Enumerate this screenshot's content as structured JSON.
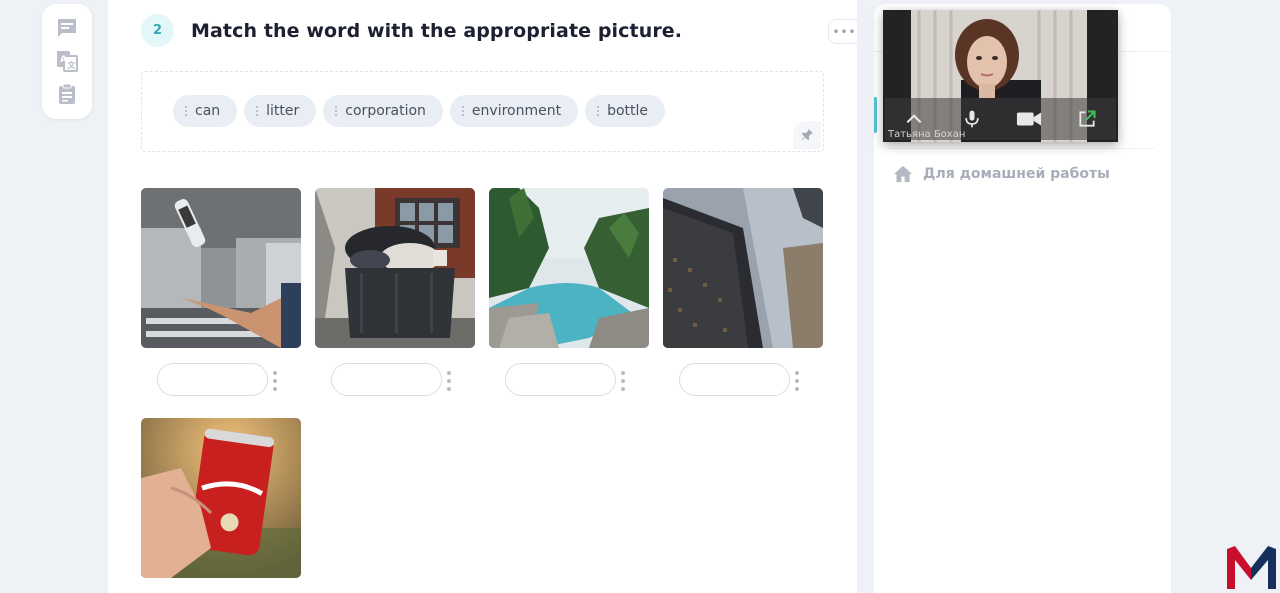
{
  "task": {
    "number": "2",
    "title": "Match the word with the appropriate picture.",
    "more_label": "•••"
  },
  "word_bank": [
    "can",
    "litter",
    "corporation",
    "environment",
    "bottle"
  ],
  "pictures": [
    {
      "subject": "tossed-can-factory",
      "answer": ""
    },
    {
      "subject": "overflowing-dumpster",
      "answer": ""
    },
    {
      "subject": "river-forest",
      "answer": ""
    },
    {
      "subject": "office-skyscraper",
      "answer": ""
    },
    {
      "subject": "hand-holding-red-can",
      "answer": ""
    }
  ],
  "side_panel": {
    "homework_label": "Для домашней работы"
  },
  "video": {
    "participant_name": "Татьяна Бохан"
  },
  "icons": {
    "toolbar": [
      "chat-icon",
      "translate-icon",
      "clipboard-icon"
    ],
    "video": [
      "chevron-up-icon",
      "microphone-icon",
      "camera-icon",
      "external-link-icon"
    ],
    "word_bank": "pin-icon",
    "side": "home-icon"
  },
  "colors": {
    "accent": "#55c3d2",
    "task_badge_bg": "#e3f6f8",
    "task_badge_fg": "#39a7b5",
    "chip_bg": "#e9edf4",
    "logo_red": "#c8102e",
    "logo_navy": "#16305c"
  }
}
